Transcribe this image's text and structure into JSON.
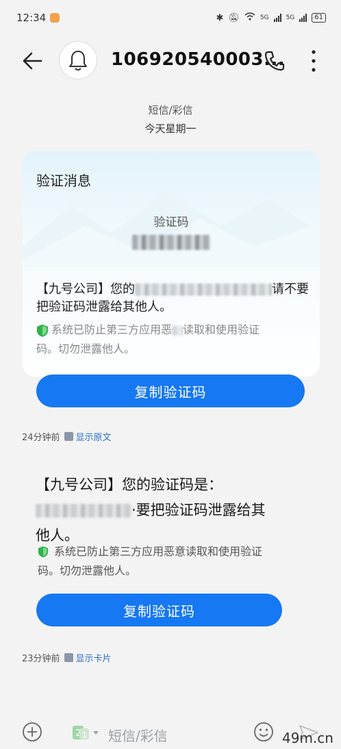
{
  "status": {
    "time": "12:34",
    "signal1": "5G",
    "signal2": "5G",
    "battery": "61"
  },
  "header": {
    "contact": "106920540003..."
  },
  "thread_meta": {
    "channel": "短信/彩信",
    "day": "今天星期一"
  },
  "card": {
    "title": "验证消息",
    "code_label": "验证码",
    "text_prefix": "【九号公司】您的",
    "text_suffix_1": "请不要",
    "text_line2": "把验证码泄露给其他人。",
    "notice_line1": "系统已防止第三方应用恶",
    "notice_line1b": "读取和使用验证",
    "notice_line2": "码。切勿泄露他人。",
    "copy_label": "复制验证码",
    "time": "24分钟前",
    "toggle": "显示原文"
  },
  "message": {
    "line1": "【九号公司】您的验证码是：",
    "line2_suffix": "·要把验证码泄露给其",
    "line3": "他人。",
    "notice_line1": "系统已防止第三方应用恶意读取和使用验证",
    "notice_line2": "码。切勿泄露他人。",
    "copy_label": "复制验证码",
    "time": "23分钟前",
    "toggle": "显示卡片"
  },
  "composer": {
    "placeholder": "短信/彩信"
  },
  "watermark": "49m.cn",
  "colors": {
    "accent": "#1678f2",
    "link": "#2a6fc9",
    "shield": "#2fb24c"
  }
}
